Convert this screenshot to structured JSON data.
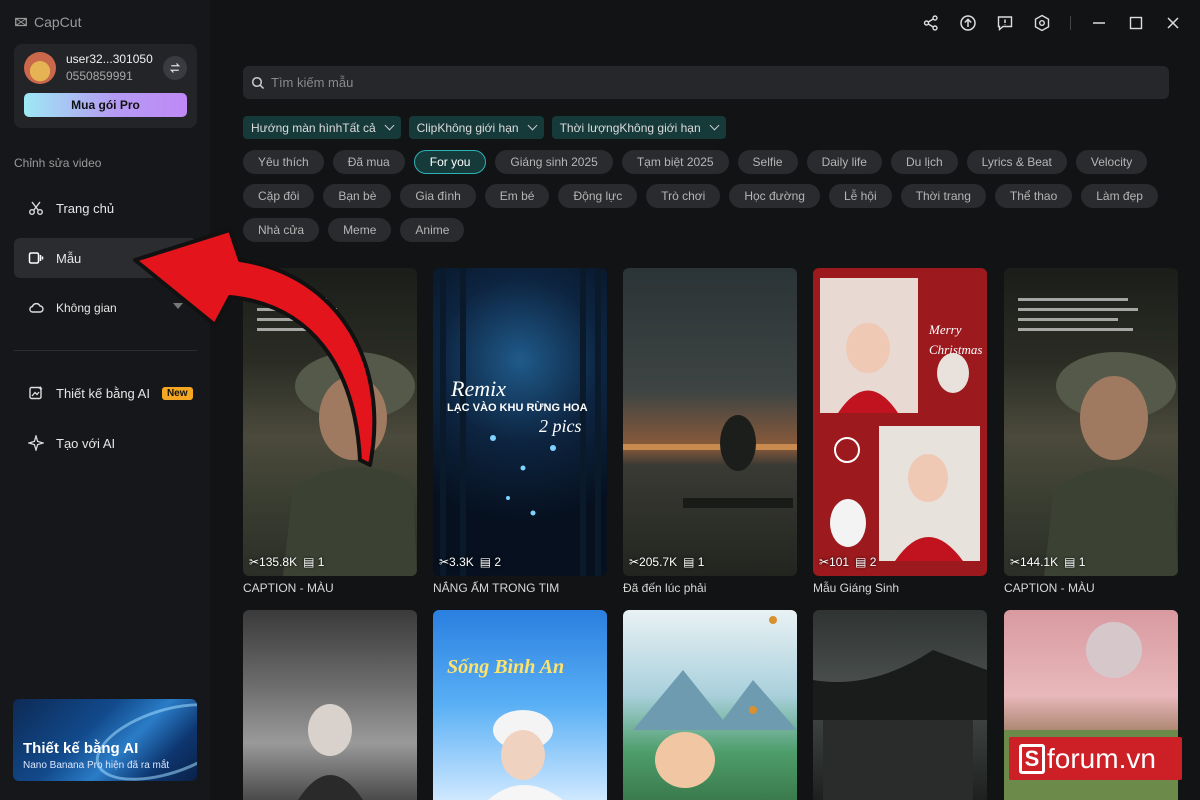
{
  "app": {
    "name": "CapCut"
  },
  "user": {
    "name": "user32...301050",
    "phone": "0550859991",
    "pro_button": "Mua gói Pro"
  },
  "sidebar": {
    "section_label": "Chỉnh sửa video",
    "items": [
      {
        "label": "Trang chủ",
        "icon": "scissors-icon"
      },
      {
        "label": "Mẫu",
        "icon": "template-icon"
      },
      {
        "label": "Không gian",
        "icon": "cloud-icon"
      },
      {
        "label": "Thiết kế bằng AI",
        "icon": "ai-design-icon",
        "badge": "New"
      },
      {
        "label": "Tạo với AI",
        "icon": "sparkle-icon"
      }
    ],
    "promo": {
      "title": "Thiết kế bằng AI",
      "subtitle": "Nano Banana Pro hiện đã ra mắt"
    }
  },
  "search": {
    "placeholder": "Tìm kiếm mẫu"
  },
  "filters": [
    {
      "label": "Hướng màn hìnhTất cả"
    },
    {
      "label": "ClipKhông giới hạn"
    },
    {
      "label": "Thời lượngKhông giới hạn"
    }
  ],
  "chips": [
    "Yêu thích",
    "Đã mua",
    "For you",
    "Giáng sinh 2025",
    "Tạm biệt 2025",
    "Selfie",
    "Daily life",
    "Du lịch",
    "Lyrics & Beat",
    "Velocity",
    "Cặp đôi",
    "Bạn bè",
    "Gia đình",
    "Em bé",
    "Động lực",
    "Trò chơi",
    "Học đường",
    "Lễ hội",
    "Thời trang",
    "Thể thao",
    "Làm đẹp",
    "Nhà cửa",
    "Meme",
    "Anime"
  ],
  "active_chip": "For you",
  "cards": [
    {
      "uses": "135.8K",
      "clips": "1",
      "title": "CAPTION - MÀU"
    },
    {
      "uses": "3.3K",
      "clips": "2",
      "title": "NẮNG ẤM TRONG TIM",
      "overlay_1": "Remix",
      "overlay_2": "LẠC VÀO KHU RỪNG HOA",
      "overlay_3": "2 pics"
    },
    {
      "uses": "205.7K",
      "clips": "1",
      "title": "Đã đến lúc phải"
    },
    {
      "uses": "101",
      "clips": "2",
      "title": "Mẫu Giáng Sinh",
      "overlay_1": "Merry Christmas"
    },
    {
      "uses": "144.1K",
      "clips": "1",
      "title": "CAPTION - MÀU"
    }
  ],
  "row2_overlays": {
    "card7": "Sống Bình An"
  },
  "watermark": {
    "s": "S",
    "text": "forum.vn"
  }
}
